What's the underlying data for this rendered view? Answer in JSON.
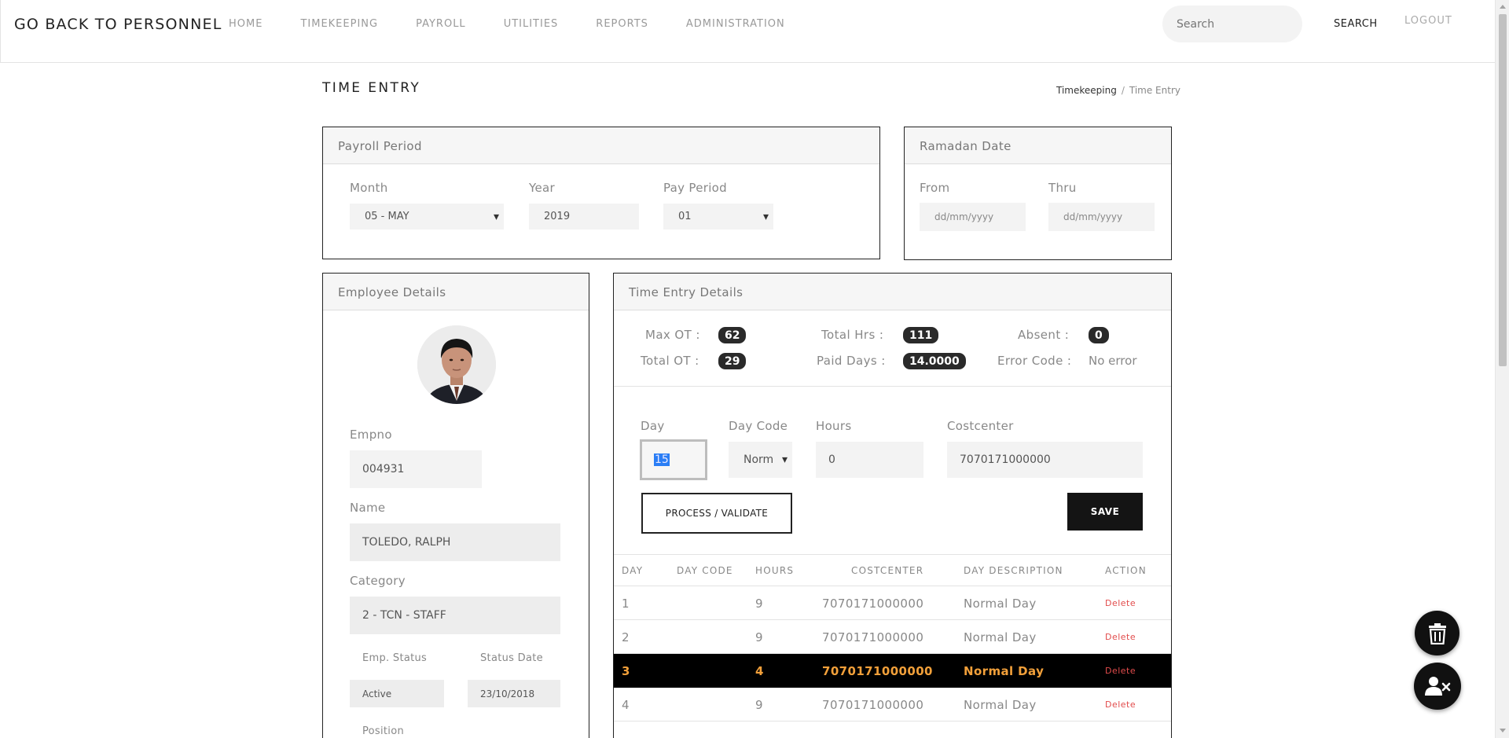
{
  "nav": {
    "brand": "GO BACK TO PERSONNEL",
    "items": [
      "HOME",
      "TIMEKEEPING",
      "PAYROLL",
      "UTILITIES",
      "REPORTS",
      "ADMINISTRATION"
    ],
    "search_placeholder": "Search",
    "search_label": "SEARCH",
    "logout_label": "LOGOUT"
  },
  "page": {
    "title": "TIME ENTRY",
    "breadcrumb": [
      "Timekeeping",
      "Time Entry"
    ]
  },
  "payroll_period": {
    "heading": "Payroll Period",
    "month_label": "Month",
    "month_value": "05 - MAY",
    "year_label": "Year",
    "year_value": "2019",
    "pay_period_label": "Pay Period",
    "pay_period_value": "01"
  },
  "ramadan": {
    "heading": "Ramadan Date",
    "from_label": "From",
    "from_placeholder": "dd/mm/yyyy",
    "thru_label": "Thru",
    "thru_placeholder": "dd/mm/yyyy"
  },
  "employee": {
    "heading": "Employee Details",
    "empno_label": "Empno",
    "empno_value": "004931",
    "name_label": "Name",
    "name_value": "TOLEDO, RALPH",
    "category_label": "Category",
    "category_value": "2 - TCN - STAFF",
    "status_label": "Emp. Status",
    "status_value": "Active",
    "status_date_label": "Status Date",
    "status_date_value": "23/10/2018",
    "position_label": "Position"
  },
  "time_entry": {
    "heading": "Time Entry Details",
    "max_ot_label": "Max OT :",
    "max_ot_value": "62",
    "total_hrs_label": "Total Hrs :",
    "total_hrs_value": "111",
    "absent_label": "Absent :",
    "absent_value": "0",
    "total_ot_label": "Total OT :",
    "total_ot_value": "29",
    "paid_days_label": "Paid Days :",
    "paid_days_value": "14.0000",
    "error_code_label": "Error Code :",
    "error_code_value": "No error",
    "day_label": "Day",
    "day_value": "15",
    "day_code_label": "Day Code",
    "day_code_value": "Norm",
    "hours_label": "Hours",
    "hours_value": "0",
    "costcenter_label": "Costcenter",
    "costcenter_value": "7070171000000",
    "process_label": "PROCESS / VALIDATE",
    "save_label": "SAVE",
    "columns": [
      "DAY",
      "DAY CODE",
      "HOURS",
      "COSTCENTER",
      "DAY DESCRIPTION",
      "ACTION"
    ],
    "rows": [
      {
        "day": "1",
        "day_code": "",
        "hours": "9",
        "costcenter": "7070171000000",
        "description": "Normal Day",
        "action": "Delete"
      },
      {
        "day": "2",
        "day_code": "",
        "hours": "9",
        "costcenter": "7070171000000",
        "description": "Normal Day",
        "action": "Delete"
      },
      {
        "day": "3",
        "day_code": "",
        "hours": "4",
        "costcenter": "7070171000000",
        "description": "Normal Day",
        "action": "Delete"
      },
      {
        "day": "4",
        "day_code": "",
        "hours": "9",
        "costcenter": "7070171000000",
        "description": "Normal Day",
        "action": "Delete"
      }
    ]
  },
  "colors": {
    "accent_row_text": "#f2a03a",
    "delete_link": "#e24c4c",
    "pill_bg": "#2a2a2a"
  },
  "icons": [
    "trash-icon",
    "user-remove-icon"
  ]
}
